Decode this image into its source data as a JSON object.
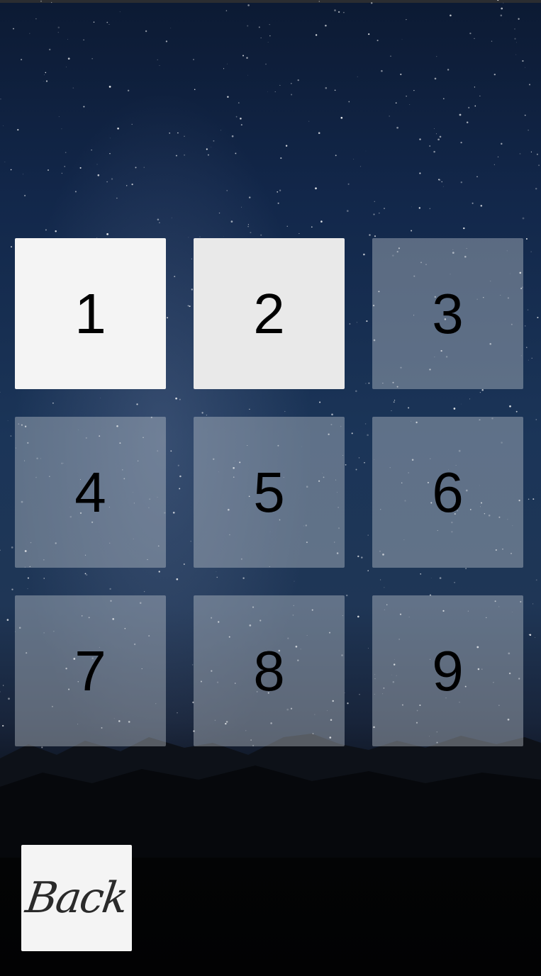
{
  "level_grid": {
    "levels": [
      {
        "label": "1",
        "unlocked": true
      },
      {
        "label": "2",
        "unlocked": true
      },
      {
        "label": "3",
        "unlocked": false
      },
      {
        "label": "4",
        "unlocked": false
      },
      {
        "label": "5",
        "unlocked": false
      },
      {
        "label": "6",
        "unlocked": false
      },
      {
        "label": "7",
        "unlocked": false
      },
      {
        "label": "8",
        "unlocked": false
      },
      {
        "label": "9",
        "unlocked": false
      }
    ]
  },
  "back_button": {
    "label": "Back"
  }
}
